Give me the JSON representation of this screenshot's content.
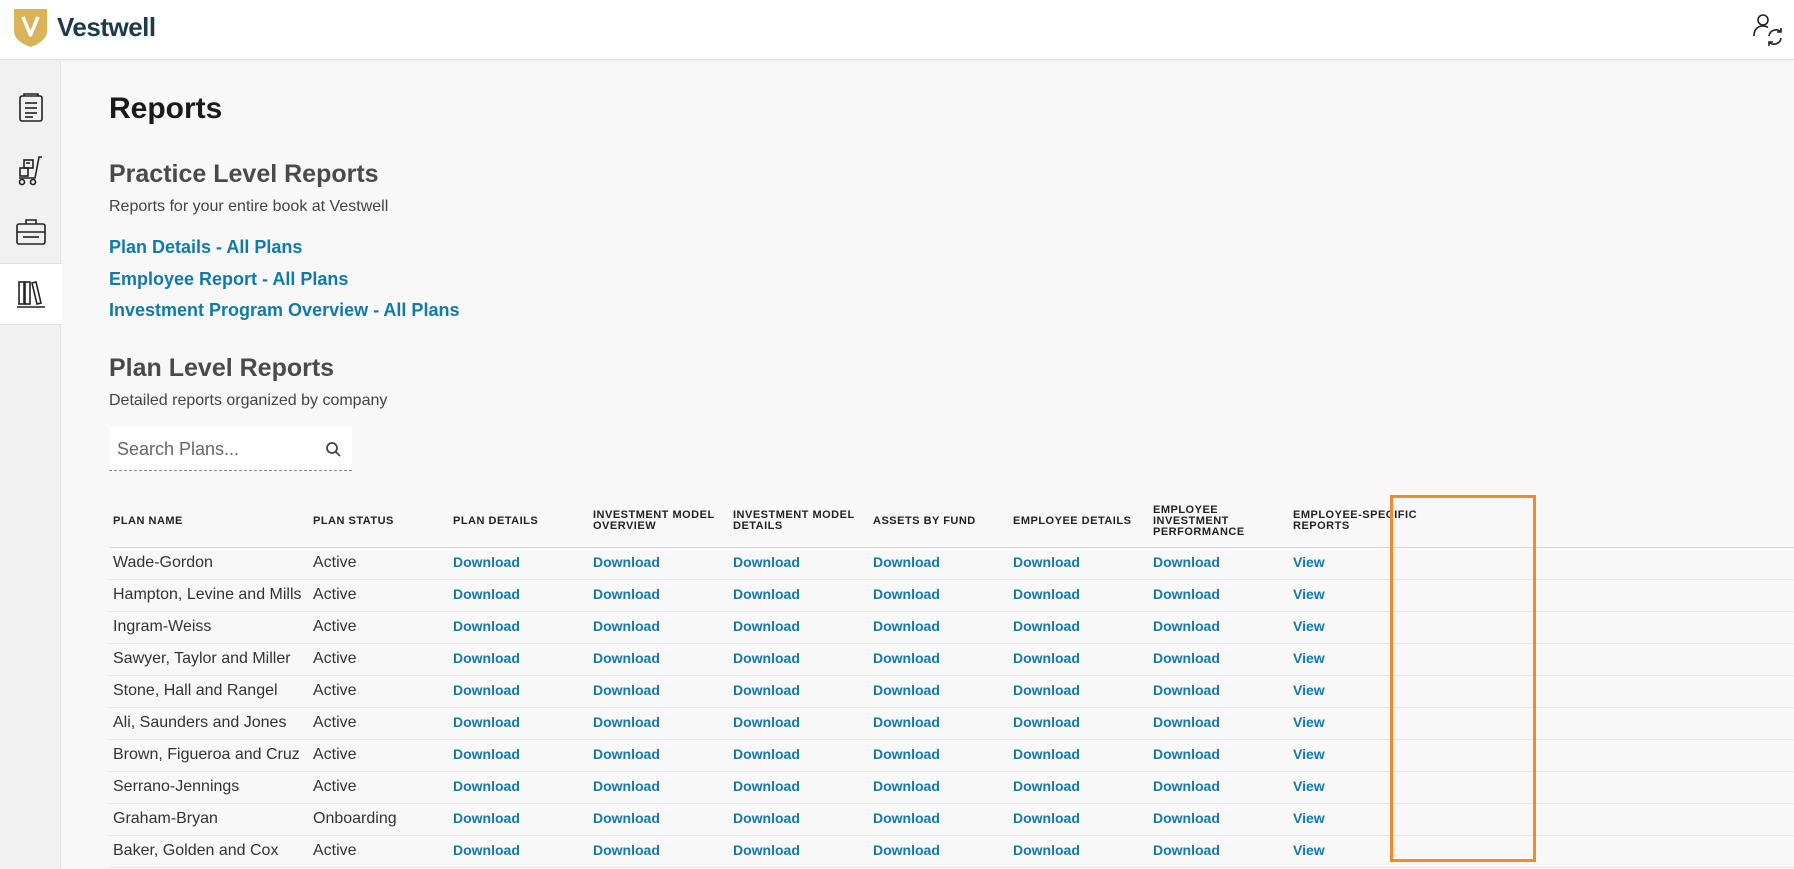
{
  "app": {
    "brand": "Vestwell",
    "brand_color": "#1d3a4c",
    "accent": "#127aa8",
    "highlight_color": "#f28c28"
  },
  "sidebar": {
    "items": [
      {
        "icon": "document-list-icon",
        "active": false
      },
      {
        "icon": "dolly-icon",
        "active": false
      },
      {
        "icon": "briefcase-icon",
        "active": false
      },
      {
        "icon": "books-icon",
        "active": true
      }
    ]
  },
  "page": {
    "title": "Reports"
  },
  "practice": {
    "title": "Practice Level Reports",
    "desc": "Reports for your entire book at Vestwell",
    "links": [
      "Plan Details - All Plans",
      "Employee Report - All Plans",
      "Investment Program Overview - All Plans"
    ]
  },
  "plan_level": {
    "title": "Plan Level Reports",
    "desc": "Detailed reports organized by company",
    "search_placeholder": "Search Plans..."
  },
  "table": {
    "headers": {
      "name": "PLAN NAME",
      "status": "PLAN STATUS",
      "plan_details": "PLAN DETAILS",
      "inv_model_overview": "INVESTMENT MODEL OVERVIEW",
      "inv_model_details": "INVESTMENT MODEL DETAILS",
      "assets_by_fund": "ASSETS BY FUND",
      "employee_details": "EMPLOYEE DETAILS",
      "employee_inv_perf": "EMPLOYEE INVESTMENT PERFORMANCE",
      "employee_specific": "EMPLOYEE-SPECIFIC REPORTS"
    },
    "download_label": "Download",
    "view_label": "View",
    "rows": [
      {
        "name": "Wade-Gordon",
        "status": "Active"
      },
      {
        "name": "Hampton, Levine and Mills",
        "status": "Active"
      },
      {
        "name": "Ingram-Weiss",
        "status": "Active"
      },
      {
        "name": "Sawyer, Taylor and Miller",
        "status": "Active"
      },
      {
        "name": "Stone, Hall and Rangel",
        "status": "Active"
      },
      {
        "name": "Ali, Saunders and Jones",
        "status": "Active"
      },
      {
        "name": "Brown, Figueroa and Cruz",
        "status": "Active"
      },
      {
        "name": "Serrano-Jennings",
        "status": "Active"
      },
      {
        "name": "Graham-Bryan",
        "status": "Onboarding"
      },
      {
        "name": "Baker, Golden and Cox",
        "status": "Active"
      }
    ]
  }
}
